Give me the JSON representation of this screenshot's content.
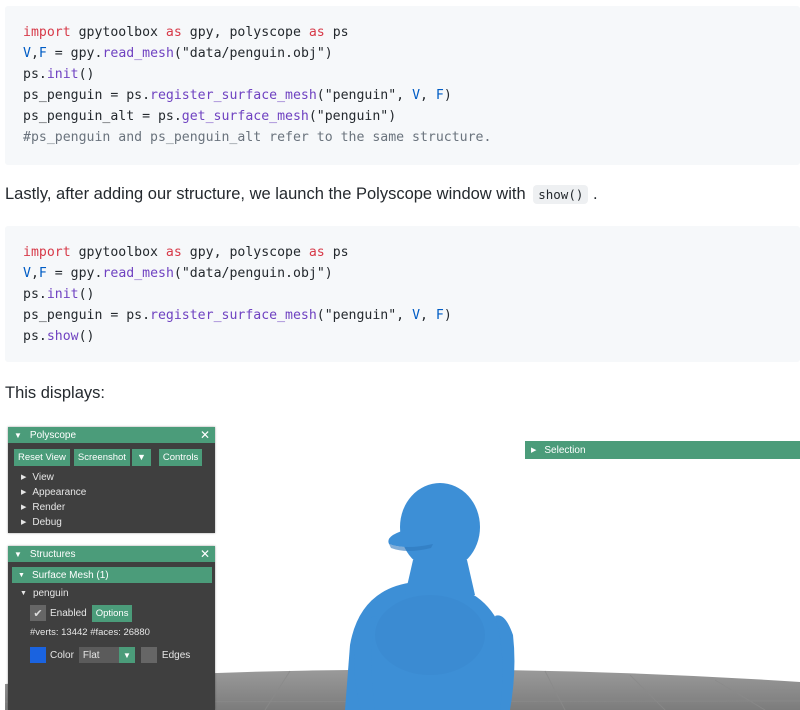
{
  "code_block_1": {
    "lines": [
      [
        {
          "t": "kw",
          "v": "import"
        },
        {
          "t": "",
          "v": " gpytoolbox "
        },
        {
          "t": "kw",
          "v": "as"
        },
        {
          "t": "",
          "v": " gpy, polyscope "
        },
        {
          "t": "kw",
          "v": "as"
        },
        {
          "t": "",
          "v": " ps"
        }
      ],
      [
        {
          "t": "nm",
          "v": "V"
        },
        {
          "t": "",
          "v": ","
        },
        {
          "t": "nm",
          "v": "F"
        },
        {
          "t": "",
          "v": " = gpy."
        },
        {
          "t": "fn",
          "v": "read_mesh"
        },
        {
          "t": "str",
          "v": "(\"data/penguin.obj\")"
        }
      ],
      [
        {
          "t": "",
          "v": "ps."
        },
        {
          "t": "fn",
          "v": "init"
        },
        {
          "t": "",
          "v": "()"
        }
      ],
      [
        {
          "t": "",
          "v": "ps_penguin = ps."
        },
        {
          "t": "fn",
          "v": "register_surface_mesh"
        },
        {
          "t": "",
          "v": "(\"penguin\", "
        },
        {
          "t": "nm",
          "v": "V"
        },
        {
          "t": "",
          "v": ", "
        },
        {
          "t": "nm",
          "v": "F"
        },
        {
          "t": "",
          "v": ")"
        }
      ],
      [
        {
          "t": "",
          "v": "ps_penguin_alt = ps."
        },
        {
          "t": "fn",
          "v": "get_surface_mesh"
        },
        {
          "t": "",
          "v": "(\"penguin\")"
        }
      ],
      [
        {
          "t": "cm",
          "v": "#ps_penguin and ps_penguin_alt refer to the same structure."
        }
      ]
    ]
  },
  "prose_1": {
    "text": "Lastly, after adding our structure, we launch the Polyscope window with",
    "code": "show()",
    "suffix": "."
  },
  "code_block_2": {
    "lines": [
      [
        {
          "t": "kw",
          "v": "import"
        },
        {
          "t": "",
          "v": " gpytoolbox "
        },
        {
          "t": "kw",
          "v": "as"
        },
        {
          "t": "",
          "v": " gpy, polyscope "
        },
        {
          "t": "kw",
          "v": "as"
        },
        {
          "t": "",
          "v": " ps"
        }
      ],
      [
        {
          "t": "nm",
          "v": "V"
        },
        {
          "t": "",
          "v": ","
        },
        {
          "t": "nm",
          "v": "F"
        },
        {
          "t": "",
          "v": " = gpy."
        },
        {
          "t": "fn",
          "v": "read_mesh"
        },
        {
          "t": "str",
          "v": "(\"data/penguin.obj\")"
        }
      ],
      [
        {
          "t": "",
          "v": "ps."
        },
        {
          "t": "fn",
          "v": "init"
        },
        {
          "t": "",
          "v": "()"
        }
      ],
      [
        {
          "t": "",
          "v": "ps_penguin = ps."
        },
        {
          "t": "fn",
          "v": "register_surface_mesh"
        },
        {
          "t": "",
          "v": "(\"penguin\", "
        },
        {
          "t": "nm",
          "v": "V"
        },
        {
          "t": "",
          "v": ", "
        },
        {
          "t": "nm",
          "v": "F"
        },
        {
          "t": "",
          "v": ")"
        }
      ],
      [
        {
          "t": "",
          "v": "ps."
        },
        {
          "t": "fn",
          "v": "show"
        },
        {
          "t": "",
          "v": "()"
        }
      ]
    ]
  },
  "prose_2": {
    "text": "This displays:"
  },
  "viewer": {
    "polyscope_panel": {
      "title": "Polyscope",
      "buttons": {
        "reset_view": "Reset View",
        "screenshot": "Screenshot",
        "controls": "Controls"
      },
      "items": [
        "View",
        "Appearance",
        "Render",
        "Debug"
      ]
    },
    "structures_panel": {
      "title": "Structures",
      "section": "Surface Mesh (1)",
      "mesh_name": "penguin",
      "enabled_label": "Enabled",
      "options_label": "Options",
      "stats": "#verts: 13442  #faces: 26880",
      "color_label": "Color",
      "shading_value": "Flat",
      "edges_label": "Edges",
      "mesh_color": "#1a63e0"
    },
    "selection_panel": {
      "title": "Selection"
    },
    "accent_color": "#4b9c7a",
    "penguin_color": "#3d8fd6"
  }
}
